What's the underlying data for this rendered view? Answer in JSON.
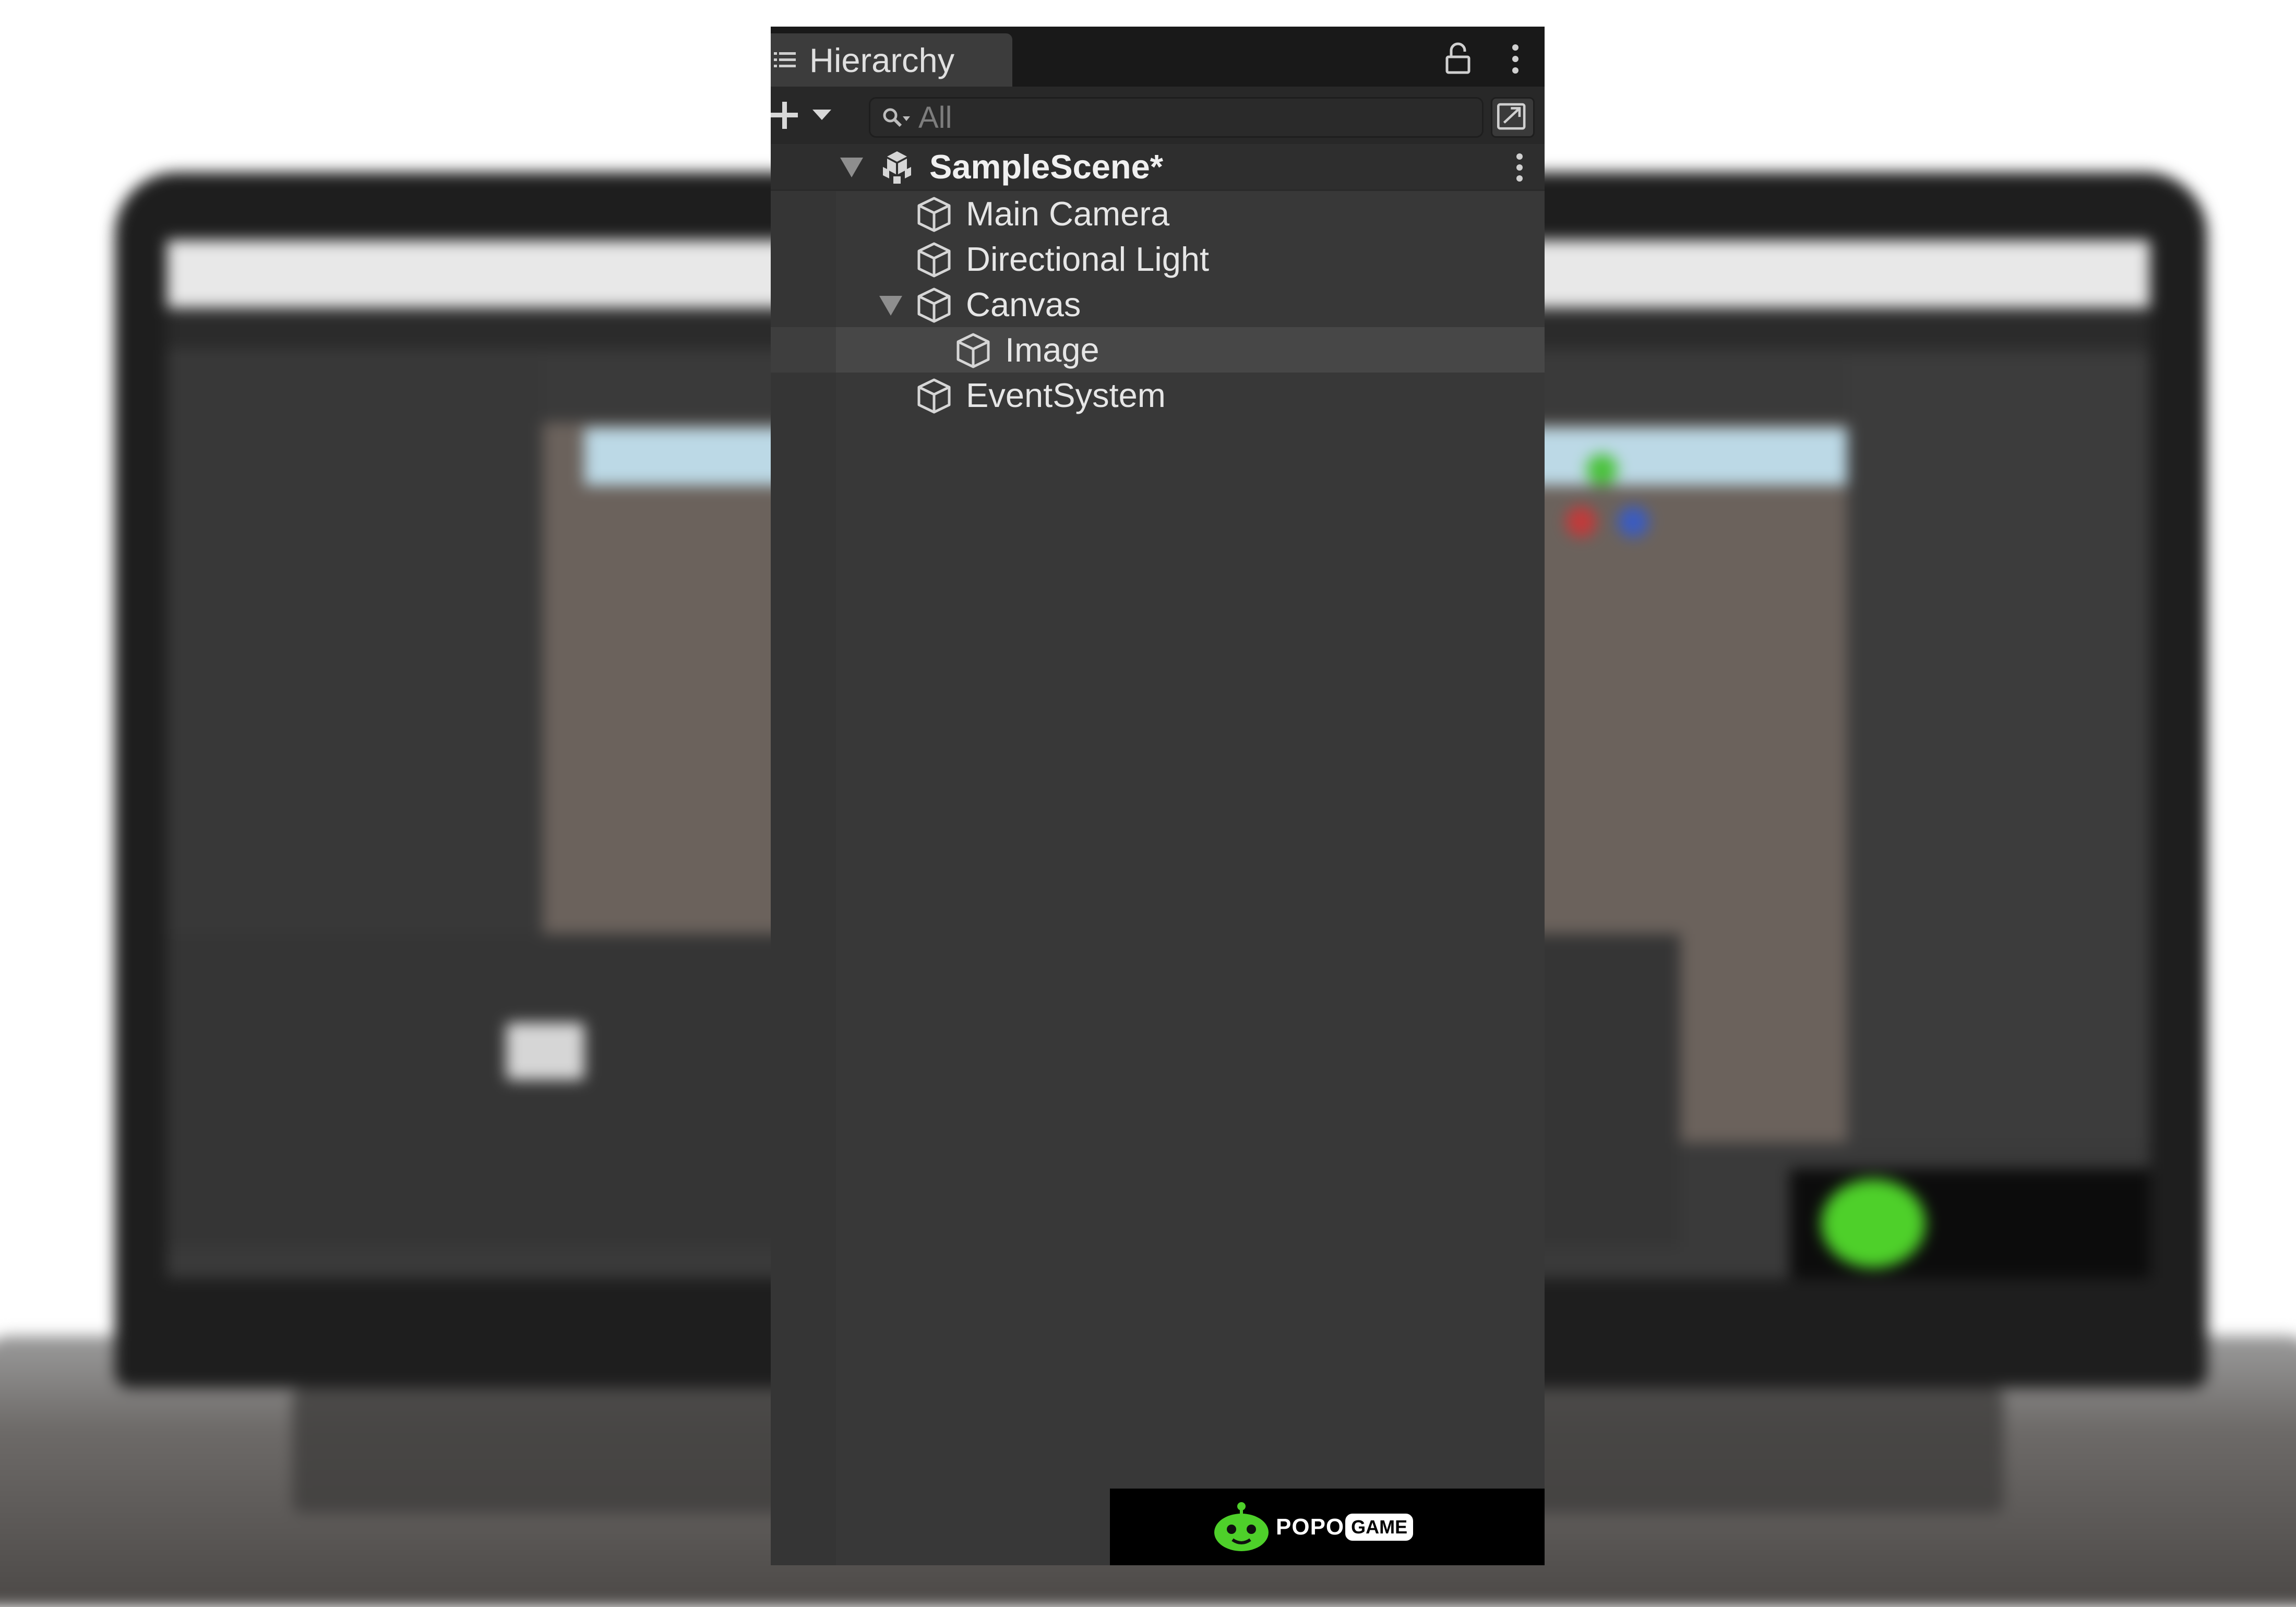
{
  "hierarchy": {
    "tab_title": "Hierarchy",
    "search": {
      "placeholder": "All",
      "value": ""
    },
    "scene": {
      "name": "SampleScene*",
      "expanded": true
    },
    "items": [
      {
        "label": "Main Camera",
        "depth": 1,
        "expanded": null,
        "selected": false
      },
      {
        "label": "Directional Light",
        "depth": 1,
        "expanded": null,
        "selected": false
      },
      {
        "label": "Canvas",
        "depth": 1,
        "expanded": true,
        "selected": false
      },
      {
        "label": "Image",
        "depth": 2,
        "expanded": null,
        "selected": true
      },
      {
        "label": "EventSystem",
        "depth": 1,
        "expanded": null,
        "selected": false
      }
    ]
  },
  "icons": {
    "tab": "list-icon",
    "lock": "lock-icon",
    "menu": "kebab-menu-icon",
    "add": "plus-icon",
    "dropdown": "triangle-down-icon",
    "search": "search-icon",
    "expand": "expand-window-icon",
    "scene": "unity-scene-icon",
    "gameobject": "cube-icon"
  },
  "watermark": {
    "brand": "POPO",
    "brand_tag": "GAME"
  },
  "colors": {
    "panel_bg": "#383838",
    "toolbar_bg": "#282828",
    "tab_bg": "#3c3c3c",
    "selected_row": "#474747",
    "text": "#e6e6e6",
    "logo_green": "#4ed02a"
  }
}
